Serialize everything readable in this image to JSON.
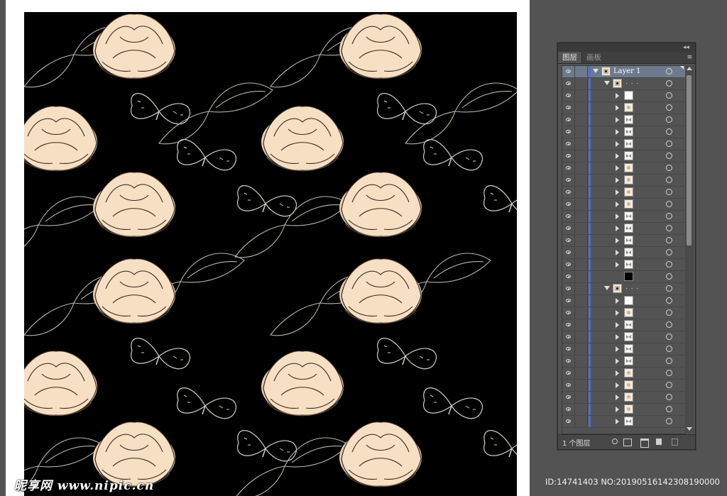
{
  "panel": {
    "tabs": [
      {
        "label": "图层",
        "active": true
      },
      {
        "label": "画板",
        "active": false
      }
    ],
    "collapse_glyph": "◂◂",
    "menu_glyph": "≡",
    "footer": {
      "layer_count": "1 个图层"
    },
    "rows": [
      {
        "type": "layer",
        "name": "Layer 1",
        "thumb": "mixed",
        "expanded": true,
        "selected": true
      },
      {
        "type": "group",
        "name": ". . .",
        "thumb": "mixed",
        "expanded": true,
        "indent": 1
      },
      {
        "type": "item",
        "thumb": "white",
        "indent": 2
      },
      {
        "type": "item",
        "thumb": "floral",
        "indent": 2
      },
      {
        "type": "item",
        "thumb": "fly",
        "indent": 2
      },
      {
        "type": "item",
        "thumb": "fly",
        "indent": 2
      },
      {
        "type": "item",
        "thumb": "fly",
        "indent": 2
      },
      {
        "type": "item",
        "thumb": "fly",
        "indent": 2
      },
      {
        "type": "item",
        "thumb": "floral",
        "indent": 2
      },
      {
        "type": "item",
        "thumb": "floral",
        "indent": 2
      },
      {
        "type": "item",
        "thumb": "floral",
        "indent": 2
      },
      {
        "type": "item",
        "thumb": "floral",
        "indent": 2
      },
      {
        "type": "item",
        "thumb": "fly",
        "indent": 2
      },
      {
        "type": "item",
        "thumb": "fly",
        "indent": 2
      },
      {
        "type": "item",
        "thumb": "fly",
        "indent": 2
      },
      {
        "type": "item",
        "thumb": "fly",
        "indent": 2
      },
      {
        "type": "item",
        "thumb": "fly",
        "indent": 2
      },
      {
        "type": "item",
        "thumb": "black",
        "indent": 2,
        "no_arrow": true
      },
      {
        "type": "group",
        "name": ". . .",
        "thumb": "mixed",
        "expanded": true,
        "indent": 1
      },
      {
        "type": "item",
        "thumb": "white",
        "indent": 2
      },
      {
        "type": "item",
        "thumb": "floral",
        "indent": 2
      },
      {
        "type": "item",
        "thumb": "fly",
        "indent": 2
      },
      {
        "type": "item",
        "thumb": "fly",
        "indent": 2
      },
      {
        "type": "item",
        "thumb": "fly",
        "indent": 2
      },
      {
        "type": "item",
        "thumb": "fly",
        "indent": 2
      },
      {
        "type": "item",
        "thumb": "floral",
        "indent": 2
      },
      {
        "type": "item",
        "thumb": "floral",
        "indent": 2
      },
      {
        "type": "item",
        "thumb": "floral",
        "indent": 2
      },
      {
        "type": "item",
        "thumb": "floral",
        "indent": 2
      },
      {
        "type": "item",
        "thumb": "fly",
        "indent": 2
      }
    ]
  },
  "watermark": {
    "text": "昵享网 www.nipic.cn"
  },
  "image_id": {
    "text": "ID:14741403 NO:20190516142308190000"
  },
  "colors": {
    "workspace": "#535353",
    "artwork_bg": "#000000",
    "flower": "#f6dfc3",
    "line": "#b8b8a8",
    "selection": "#6d7a8d",
    "layer_bar": "#4d6fd1"
  }
}
